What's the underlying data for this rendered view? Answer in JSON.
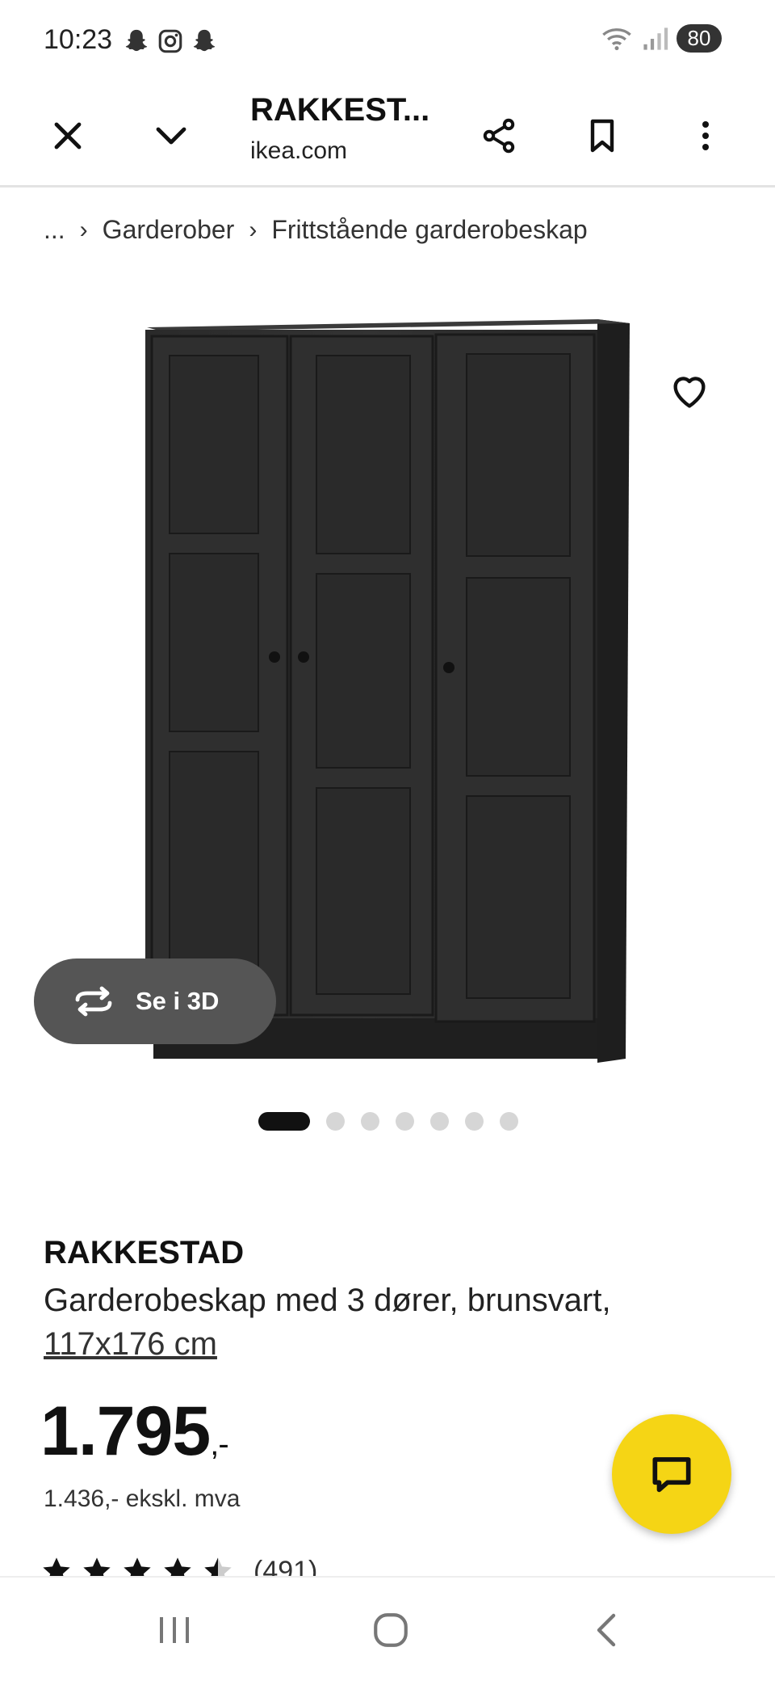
{
  "status_bar": {
    "time": "10:23",
    "battery": "80",
    "left_icons": [
      "snapchat-icon",
      "instagram-icon",
      "snapchat-icon"
    ],
    "right_icons": [
      "wifi-icon",
      "signal-icon"
    ]
  },
  "browser": {
    "title": "RAKKEST...",
    "domain": "ikea.com",
    "buttons": [
      "close-icon",
      "chevron-down-icon",
      "share-icon",
      "bookmark-icon",
      "more-icon"
    ]
  },
  "breadcrumb": {
    "items": [
      "...",
      "Garderober",
      "Frittstående garderobeskap"
    ]
  },
  "gallery": {
    "see_3d_label": "Se i 3D",
    "dot_count": 7,
    "active_index": 0
  },
  "product": {
    "name": "RAKKESTAD",
    "description": "Garderobeskap med 3 dører, brunsvart,",
    "size": "117x176 cm",
    "price": "1.795",
    "price_suffix": ",-",
    "price_ex_vat": "1.436,- ekskl. mva",
    "rating_stars": 4.5,
    "rating_count": "(491)"
  },
  "colors": {
    "chat_fab": "#f5d515",
    "see_3d_bg": "#555555"
  }
}
